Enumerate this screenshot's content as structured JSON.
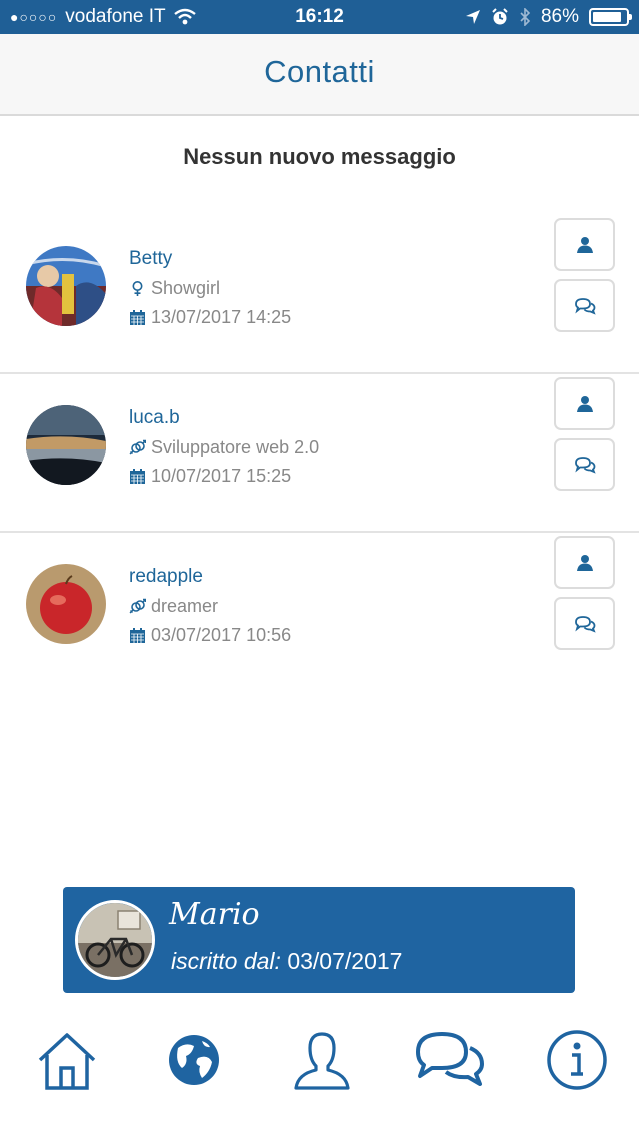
{
  "status_bar": {
    "signal": "●○○○○",
    "carrier": "vodafone IT",
    "time": "16:12",
    "battery_text": "86%",
    "battery_level": 0.86
  },
  "header": {
    "title": "Contatti"
  },
  "messages": {
    "empty_text": "Nessun nuovo messaggio"
  },
  "contacts": [
    {
      "name": "Betty",
      "job": "Showgirl",
      "gender_icon": "female-icon",
      "date": "13/07/2017 14:25"
    },
    {
      "name": "luca.b",
      "job": "Sviluppatore web 2.0",
      "gender_icon": "gender-mixed-icon",
      "date": "10/07/2017 15:25"
    },
    {
      "name": "redapple",
      "job": "dreamer",
      "gender_icon": "gender-mixed-icon",
      "date": "03/07/2017 10:56"
    }
  ],
  "user_card": {
    "name": "Mario",
    "since_label": "iscritto dal:",
    "since_date": "03/07/2017"
  },
  "tab_bar": {
    "items": [
      {
        "icon": "home-icon"
      },
      {
        "icon": "globe-icon"
      },
      {
        "icon": "user-icon"
      },
      {
        "icon": "chat-icon"
      },
      {
        "icon": "info-icon"
      }
    ]
  },
  "colors": {
    "primary": "#1f64a1",
    "text_blue": "#1f6699",
    "muted": "#888888"
  }
}
